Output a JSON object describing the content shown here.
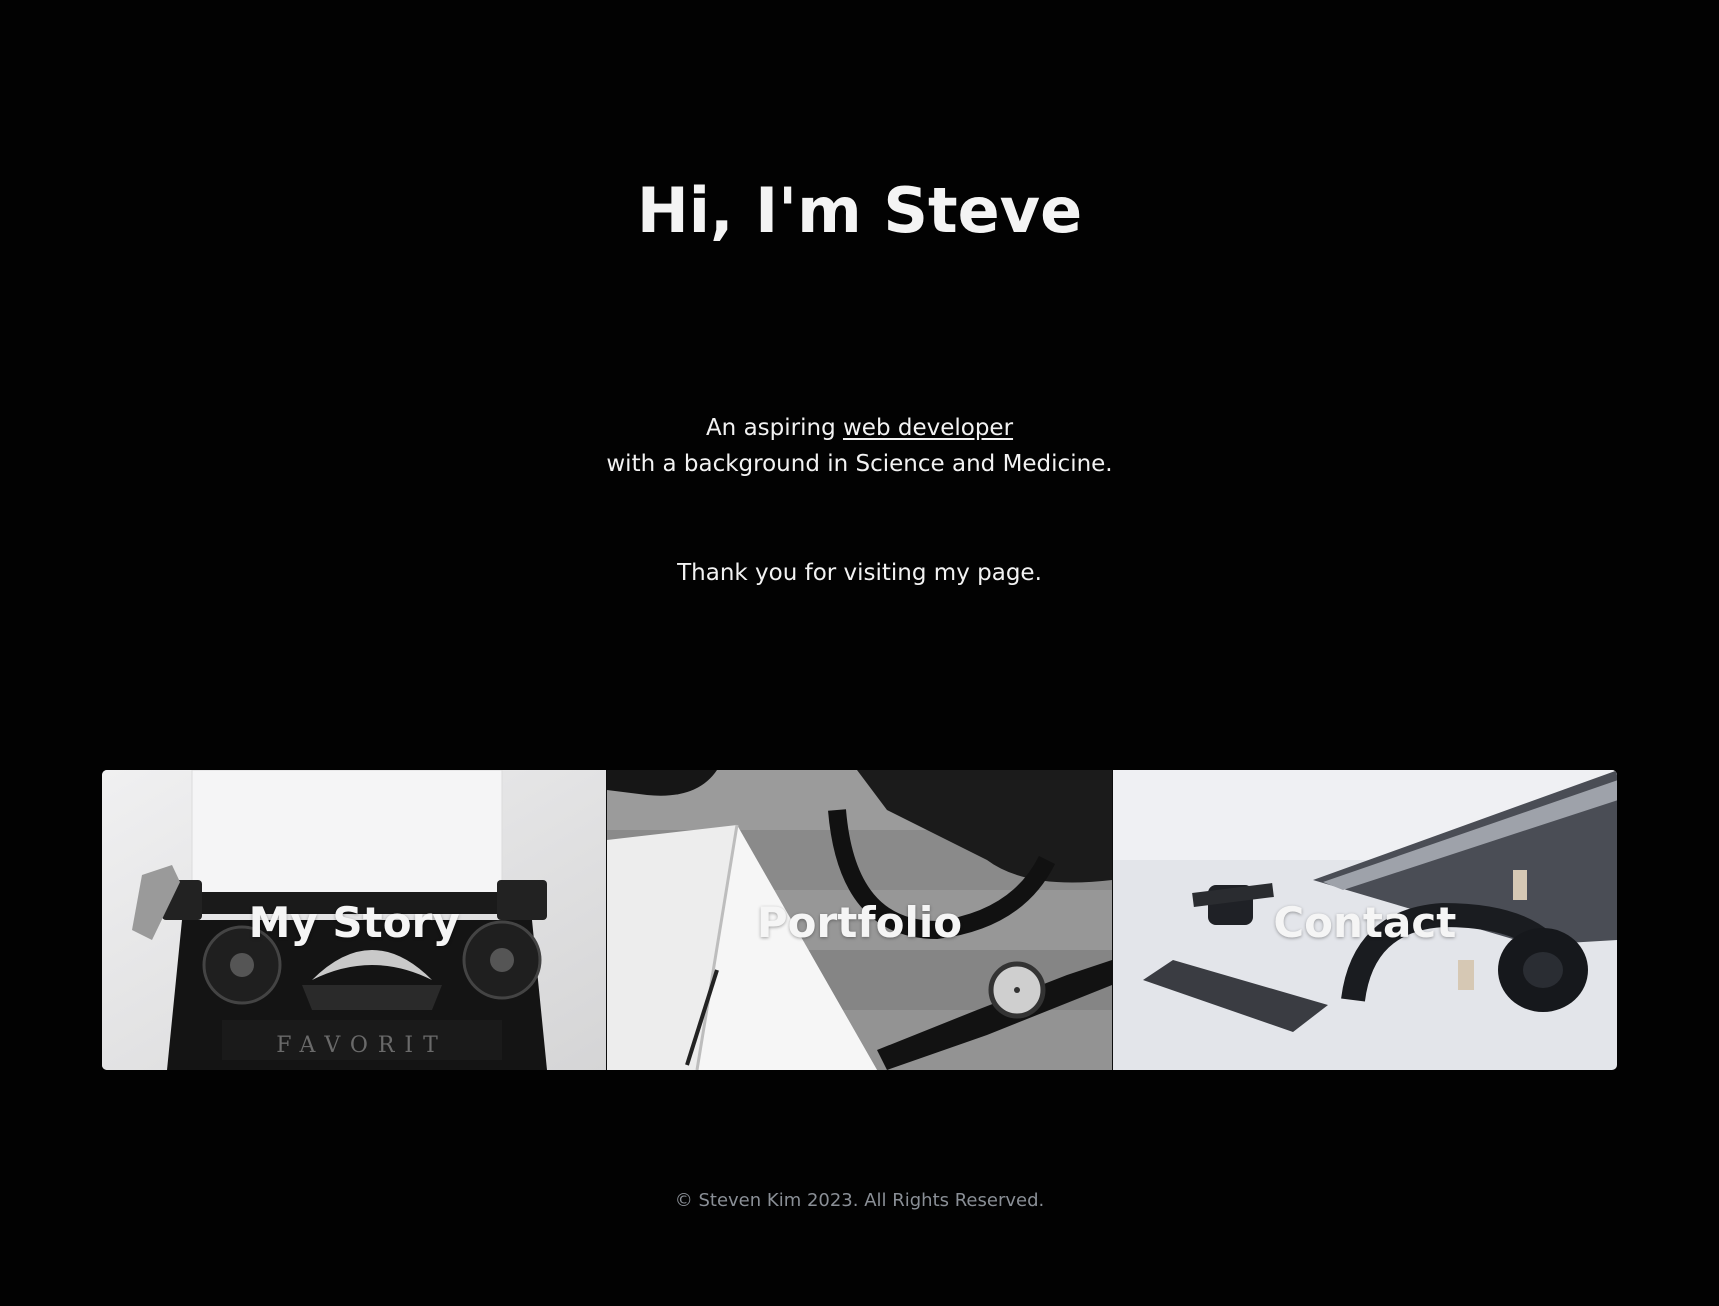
{
  "hero": {
    "title": "Hi, I'm Steve"
  },
  "intro": {
    "prefix": "An aspiring ",
    "link_text": "web developer",
    "line2": "with a background in Science and Medicine."
  },
  "thanks": "Thank you for visiting my page.",
  "cards": [
    {
      "label": "My Story",
      "image": "typewriter-photo",
      "stamp": "FAVORIT"
    },
    {
      "label": "Portfolio",
      "image": "notebook-watch-bag-photo"
    },
    {
      "label": "Contact",
      "image": "laptop-headphones-phone-photo"
    }
  ],
  "footer": {
    "copyright": "© Steven Kim 2023. All Rights Reserved."
  },
  "colors": {
    "background": "#020202",
    "text": "#f2f2f2",
    "footer_text": "#8a8f96"
  }
}
